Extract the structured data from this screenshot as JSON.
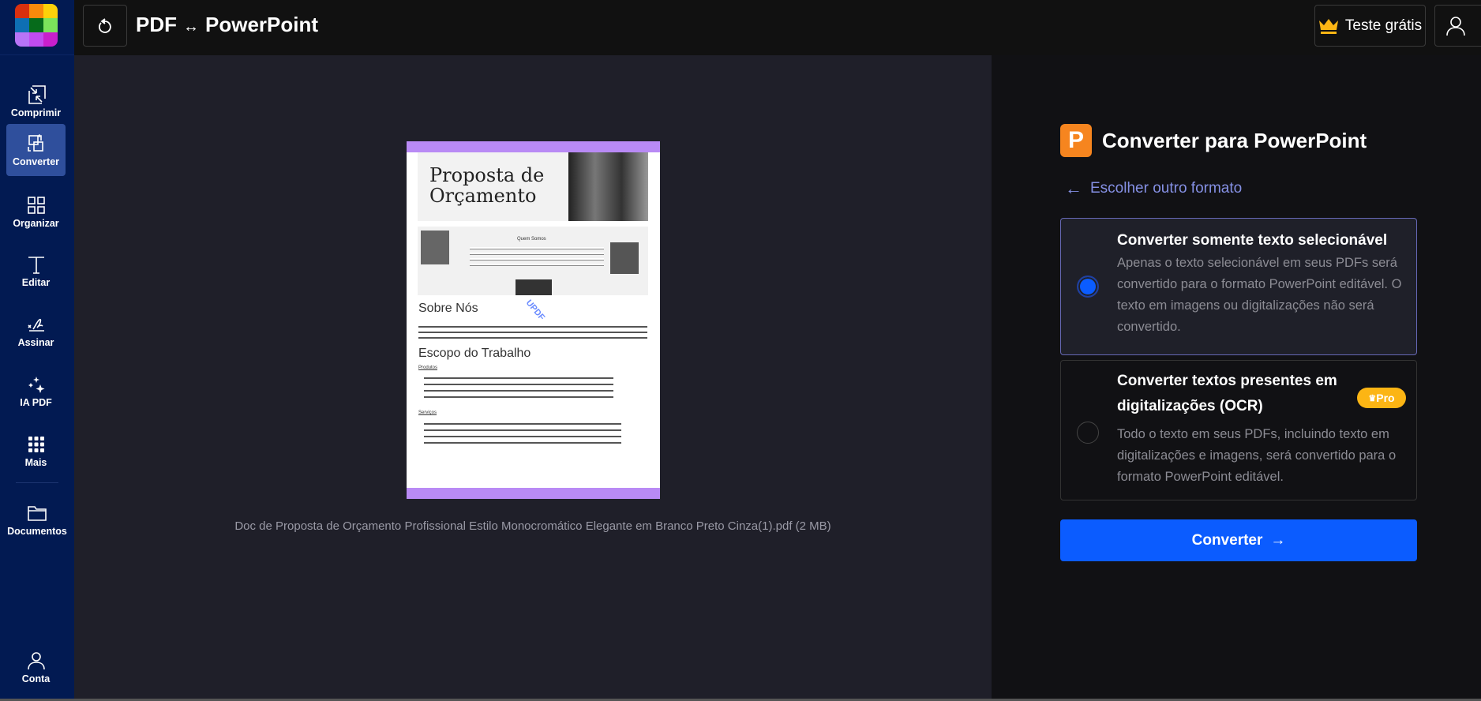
{
  "logo": {
    "colors": [
      "#d9300f",
      "#f98a0b",
      "#fdd10a",
      "#0e6fb3",
      "#066b1b",
      "#7be35b",
      "#b774f7",
      "#c04cf0",
      "#c81fcc"
    ]
  },
  "sidebar": {
    "items": [
      {
        "label": "Comprimir",
        "icon": "compress-icon"
      },
      {
        "label": "Converter",
        "icon": "convert-icon",
        "active": true
      },
      {
        "label": "Organizar",
        "icon": "grid-icon"
      },
      {
        "label": "Editar",
        "icon": "text-icon"
      },
      {
        "label": "Assinar",
        "icon": "signature-icon"
      },
      {
        "label": "IA PDF",
        "icon": "sparkles-icon"
      },
      {
        "label": "Mais",
        "icon": "dots-grid-icon"
      },
      {
        "label": "Documentos",
        "icon": "folder-icon"
      }
    ],
    "account": "Conta"
  },
  "header": {
    "title_left": "PDF",
    "title_arrow": "↔",
    "title_right": "PowerPoint",
    "trial": "Teste grátis"
  },
  "preview": {
    "filename": "Doc de Proposta de Orçamento Profissional Estilo Monocromático Elegante em Branco Preto Cinza(1).pdf (2 MB)",
    "doc": {
      "title1": "Proposta de",
      "title2": "Orçamento",
      "section1": "Sobre Nós",
      "section2": "Escopo do Trabalho",
      "sub1": "Produtos",
      "sub2": "Serviços",
      "watermark": "UPDF",
      "client": "Quem Somos"
    }
  },
  "panel": {
    "icon_letter": "P",
    "title": "Converter para PowerPoint",
    "back": "Escolher outro formato",
    "options": [
      {
        "title": "Converter somente texto selecionável",
        "desc": "Apenas o texto selecionável em seus PDFs será convertido para o formato PowerPoint editável. O texto em imagens ou digitalizações não será convertido.",
        "selected": true
      },
      {
        "title": "Converter textos presentes em digitalizações (OCR)",
        "desc": "Todo o texto em seus PDFs, incluindo texto em digitalizações e imagens, será convertido para o formato PowerPoint editável.",
        "badge": "Pro",
        "selected": false
      }
    ],
    "convert": "Converter"
  },
  "colors": {
    "accent": "#0b5cff",
    "sidebar": "#021a52",
    "pro": "#fcb514",
    "link": "#8590e4"
  }
}
